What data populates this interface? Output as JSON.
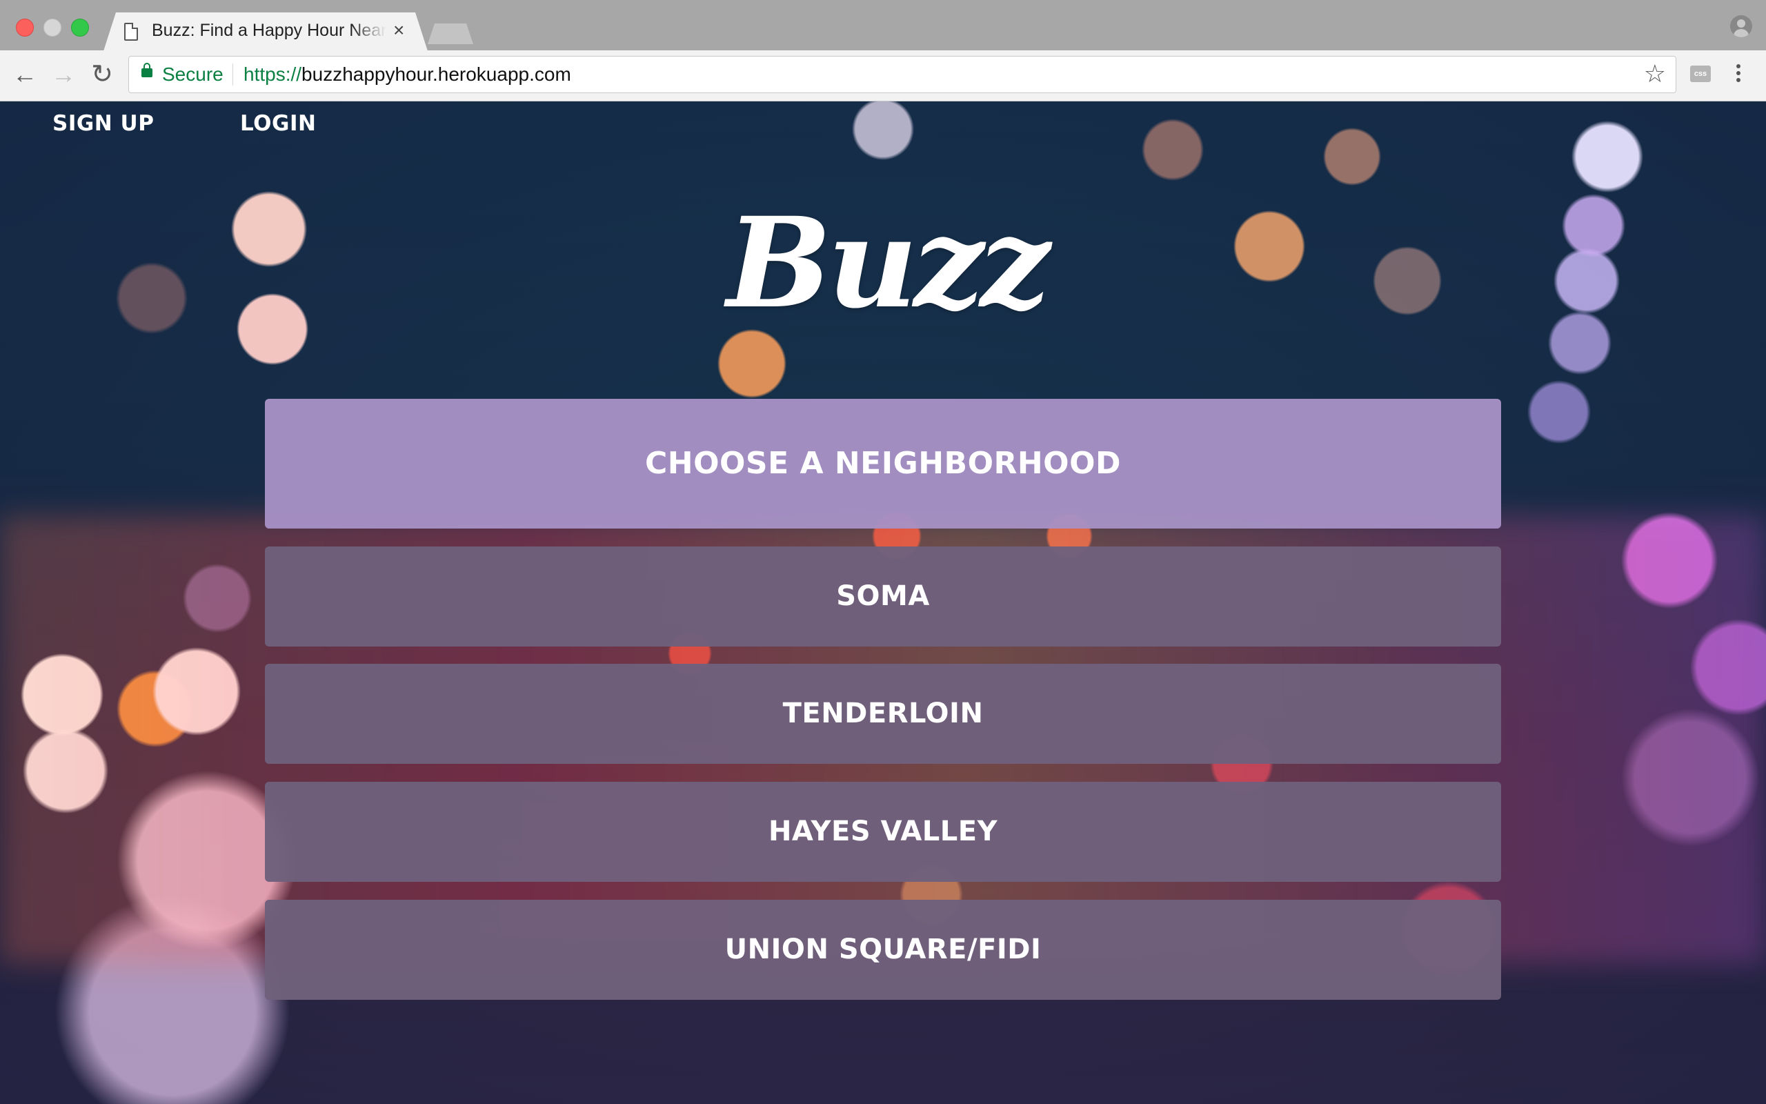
{
  "browser": {
    "tab_title": "Buzz: Find a Happy Hour Near",
    "tab_close": "×",
    "security_label": "Secure",
    "url_scheme": "https://",
    "url_host": "buzzhappyhour.herokuapp.com",
    "extension_label": "css"
  },
  "nav": {
    "sign_up": "SIGN UP",
    "login": "LOGIN"
  },
  "logo": "Buzz",
  "chooser": {
    "heading": "CHOOSE A NEIGHBORHOOD",
    "neighborhoods": [
      "SOMA",
      "TENDERLOIN",
      "HAYES VALLEY",
      "UNION SQUARE/FIDI"
    ]
  },
  "colors": {
    "header_button": "#a691c4",
    "neighborhood_button": "#70607c",
    "secure_green": "#0b8043"
  },
  "icons": [
    "back-arrow-icon",
    "forward-arrow-icon",
    "reload-icon",
    "lock-icon",
    "star-icon",
    "page-icon",
    "close-icon",
    "profile-icon",
    "menu-icon"
  ]
}
